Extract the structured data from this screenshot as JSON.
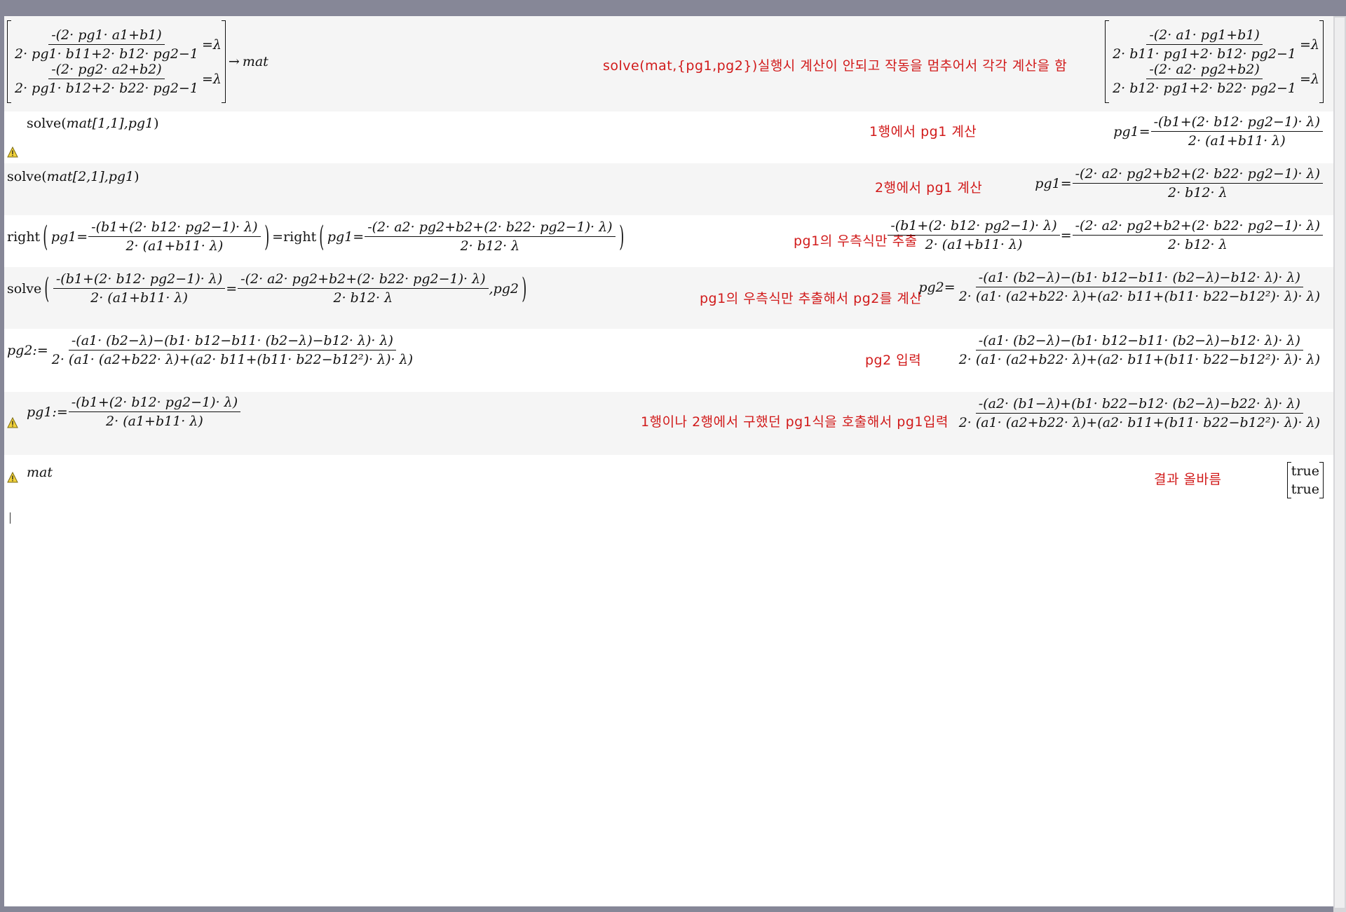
{
  "comments": {
    "r1": "solve(mat,{pg1,pg2})실행시 계산이 안되고 작동을 멈추어서 각각 계산을 함",
    "r2": "1행에서 pg1 계산",
    "r3": "2행에서 pg1 계산",
    "r4": "pg1의 우측식만 추출",
    "r5": "pg1의 우측식만 추출해서 pg2를 계산",
    "r6": "pg2 입력",
    "r7": "1행이나 2행에서 구했던 pg1식을 호출해서 pg1입력",
    "r8": "결과 올바름"
  },
  "rows": {
    "r1": {
      "in_m1_num": "-(2· pg1· a1+b1)",
      "in_m1_den": "2· pg1· b11+2· b12· pg2−1",
      "in_m1_rhs": "=λ",
      "in_m2_num": "-(2· pg2· a2+b2)",
      "in_m2_den": "2· pg1· b12+2· b22· pg2−1",
      "in_m2_rhs": "=λ",
      "in_arrow": "→",
      "in_store": "mat",
      "out_m1_num": "-(2· a1· pg1+b1)",
      "out_m1_den": "2· b11· pg1+2· b12· pg2−1",
      "out_m1_rhs": "=λ",
      "out_m2_num": "-(2· a2· pg2+b2)",
      "out_m2_den": "2· b12· pg1+2· b22· pg2−1",
      "out_m2_rhs": "=λ"
    },
    "r2": {
      "in_fn": "solve(",
      "in_args": "mat[1,1],pg1",
      "in_close": ")",
      "out_lhs": "pg1=",
      "out_num": "-(b1+(2· b12· pg2−1)· λ)",
      "out_den": "2· (a1+b11· λ)"
    },
    "r3": {
      "in_fn": "solve(",
      "in_args": "mat[2,1],pg1",
      "in_close": ")",
      "out_lhs": "pg1=",
      "out_num": "-(2· a2· pg2+b2+(2· b22· pg2−1)· λ)",
      "out_den": "2· b12· λ"
    },
    "r4": {
      "in_fn1": "right",
      "in_lhs1": "pg1=",
      "in_num1": "-(b1+(2· b12· pg2−1)· λ)",
      "in_den1": "2· (a1+b11· λ)",
      "in_eq": "=",
      "in_fn2": "right",
      "in_lhs2": "pg1=",
      "in_num2": "-(2· a2· pg2+b2+(2· b22· pg2−1)· λ)",
      "in_den2": "2· b12· λ",
      "out_num1": "-(b1+(2· b12· pg2−1)· λ)",
      "out_den1": "2· (a1+b11· λ)",
      "out_eq": "=",
      "out_num2": "-(2· a2· pg2+b2+(2· b22· pg2−1)· λ)",
      "out_den2": "2· b12· λ"
    },
    "r5": {
      "in_fn": "solve",
      "in_num1": "-(b1+(2· b12· pg2−1)· λ)",
      "in_den1": "2· (a1+b11· λ)",
      "in_eq": "=",
      "in_num2": "-(2· a2· pg2+b2+(2· b22· pg2−1)· λ)",
      "in_den2": "2· b12· λ",
      "in_var": ",pg2",
      "out_lhs": "pg2=",
      "out_num": "-(a1· (b2−λ)−(b1· b12−b11· (b2−λ)−b12· λ)· λ)",
      "out_den": "2· (a1· (a2+b22· λ)+(a2· b11+(b11· b22−b12²)· λ)· λ)"
    },
    "r6": {
      "in_lhs": "pg2:=",
      "in_num": "-(a1· (b2−λ)−(b1· b12−b11· (b2−λ)−b12· λ)· λ)",
      "in_den": "2· (a1· (a2+b22· λ)+(a2· b11+(b11· b22−b12²)· λ)· λ)",
      "out_num": "-(a1· (b2−λ)−(b1· b12−b11· (b2−λ)−b12· λ)· λ)",
      "out_den": "2· (a1· (a2+b22· λ)+(a2· b11+(b11· b22−b12²)· λ)· λ)"
    },
    "r7": {
      "in_lhs": "pg1:=",
      "in_num": "-(b1+(2· b12· pg2−1)· λ)",
      "in_den": "2· (a1+b11· λ)",
      "out_num": "-(a2· (b1−λ)+(b1· b22−b12· (b2−λ)−b22· λ)· λ)",
      "out_den": "2· (a1· (a2+b22· λ)+(a2· b11+(b11· b22−b12²)· λ)· λ)"
    },
    "r8": {
      "in_expr": "mat",
      "out_v1": "true",
      "out_v2": "true"
    }
  },
  "icons": {
    "warning": "warning-triangle-icon"
  },
  "colors": {
    "comment": "#d11a1a",
    "row_shade": "#f5f5f5",
    "frame": "#868797"
  }
}
